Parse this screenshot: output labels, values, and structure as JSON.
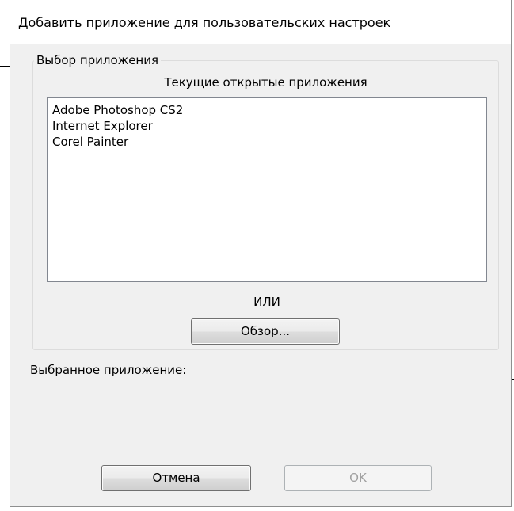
{
  "dialog": {
    "title": "Добавить приложение для пользовательских настроек"
  },
  "selection_group": {
    "legend": "Выбор приложения",
    "list_heading": "Текущие открытые приложения",
    "applications": [
      "Adobe Photoshop CS2",
      "Internet Explorer",
      "Corel Painter"
    ],
    "or_label": "ИЛИ",
    "browse_label": "Обзор..."
  },
  "selected_app": {
    "label": "Выбранное приложение:"
  },
  "footer": {
    "cancel_label": "Отмена",
    "ok_label": "OK",
    "ok_enabled": false
  },
  "colors": {
    "dialog_bg": "#f0f0f0",
    "title_bg": "#ffffff",
    "disabled_text": "#a0a0a0",
    "callout_line": "#000000"
  }
}
